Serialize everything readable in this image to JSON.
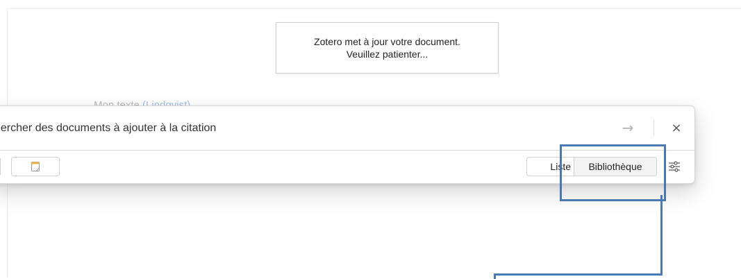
{
  "document": {
    "text_prefix": "Mon texte ",
    "text_link": "(Lindqvist)"
  },
  "notice": {
    "line1": "Zotero met à jour votre document.",
    "line2": "Veuillez patienter..."
  },
  "citation_dialog": {
    "search_placeholder": "chercher des documents à ajouter à la citation",
    "submit_arrow": "→",
    "close_symbol": "×",
    "view_toggle": {
      "options": [
        "Liste",
        "Bibliothèque"
      ],
      "selected": "Bibliothèque"
    }
  },
  "icons": {
    "arrow": "arrow-right-icon",
    "close": "close-icon",
    "note": "note-icon",
    "settings": "sliders-icon"
  },
  "colors": {
    "highlight": "#4a78b0",
    "link": "#a9bfe8",
    "note_icon": "#e8b84a"
  }
}
